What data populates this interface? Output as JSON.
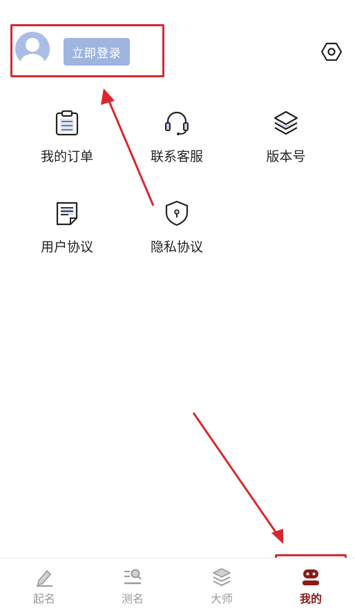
{
  "header": {
    "login_label": "立即登录",
    "avatar_icon": "user-avatar-icon",
    "settings_icon": "hexagon-settings-icon"
  },
  "menu": {
    "items": [
      {
        "label": "我的订单",
        "icon": "clipboard-icon"
      },
      {
        "label": "联系客服",
        "icon": "headset-icon"
      },
      {
        "label": "版本号",
        "icon": "layers-icon"
      },
      {
        "label": "用户协议",
        "icon": "document-icon"
      },
      {
        "label": "隐私协议",
        "icon": "shield-icon"
      }
    ]
  },
  "tabbar": {
    "active_index": 3,
    "active_color": "#8b1a16",
    "inactive_color": "#999999",
    "items": [
      {
        "label": "起名",
        "icon": "pen-icon"
      },
      {
        "label": "测名",
        "icon": "search-list-icon"
      },
      {
        "label": "大师",
        "icon": "layers-icon"
      },
      {
        "label": "我的",
        "icon": "profile-icon"
      }
    ]
  },
  "annotations": {
    "highlight_color": "#d9272e"
  }
}
